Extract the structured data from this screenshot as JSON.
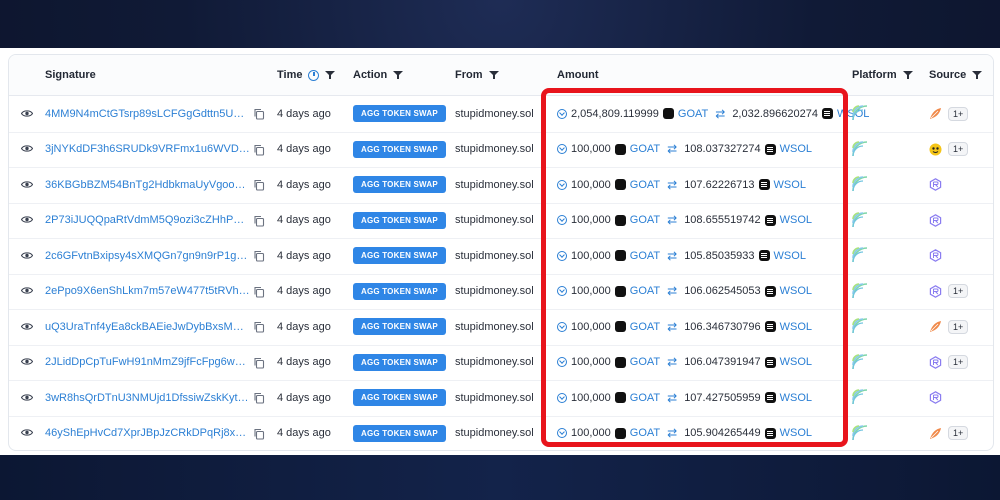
{
  "columns": {
    "signature": "Signature",
    "time": "Time",
    "action": "Action",
    "from": "From",
    "amount": "Amount",
    "platform": "Platform",
    "source": "Source"
  },
  "colors": {
    "accent": "#2b7fd4",
    "badge": "#2f86e6",
    "highlight": "#e8141c"
  },
  "rows": [
    {
      "signature": "4MM9N4mCtGTsrp89sLCFGgGdttn5UYnW...",
      "time": "4 days ago",
      "action": "AGG TOKEN SWAP",
      "from": "stupidmoney.sol",
      "amount_in": "2,054,809.119999",
      "token_in": "GOAT",
      "amount_out": "2,032.896620274",
      "token_out": "WSOL",
      "source_icon": "orange-feather-icon",
      "source_extra": "1+"
    },
    {
      "signature": "3jNYKdDF3h6SRUDk9VRFmx1u6WVDkgUrc...",
      "time": "4 days ago",
      "action": "AGG TOKEN SWAP",
      "from": "stupidmoney.sol",
      "amount_in": "100,000",
      "token_in": "GOAT",
      "amount_out": "108.037327274",
      "token_out": "WSOL",
      "source_icon": "yellow-face-icon",
      "source_extra": "1+"
    },
    {
      "signature": "36KBGbBZM54BnTg2HdbkmaUyVgoo7qaX...",
      "time": "4 days ago",
      "action": "AGG TOKEN SWAP",
      "from": "stupidmoney.sol",
      "amount_in": "100,000",
      "token_in": "GOAT",
      "amount_out": "107.62226713",
      "token_out": "WSOL",
      "source_icon": "raydium-icon",
      "source_extra": ""
    },
    {
      "signature": "2P73iJUQQpaRtVdmM5Q9ozi3cZHhPWSo...",
      "time": "4 days ago",
      "action": "AGG TOKEN SWAP",
      "from": "stupidmoney.sol",
      "amount_in": "100,000",
      "token_in": "GOAT",
      "amount_out": "108.655519742",
      "token_out": "WSOL",
      "source_icon": "raydium-icon",
      "source_extra": ""
    },
    {
      "signature": "2c6GFvtnBxipsy4sXMQGn7gn9n9rP1gcVN...",
      "time": "4 days ago",
      "action": "AGG TOKEN SWAP",
      "from": "stupidmoney.sol",
      "amount_in": "100,000",
      "token_in": "GOAT",
      "amount_out": "105.85035933",
      "token_out": "WSOL",
      "source_icon": "raydium-icon",
      "source_extra": ""
    },
    {
      "signature": "2ePpo9X6enShLkm7m57eW477t5tRVhE6iL...",
      "time": "4 days ago",
      "action": "AGG TOKEN SWAP",
      "from": "stupidmoney.sol",
      "amount_in": "100,000",
      "token_in": "GOAT",
      "amount_out": "106.062545053",
      "token_out": "WSOL",
      "source_icon": "raydium-icon",
      "source_extra": "1+"
    },
    {
      "signature": "uQ3UraTnf4yEa8ckBAEieJwDybBxsMWp8D...",
      "time": "4 days ago",
      "action": "AGG TOKEN SWAP",
      "from": "stupidmoney.sol",
      "amount_in": "100,000",
      "token_in": "GOAT",
      "amount_out": "106.346730796",
      "token_out": "WSOL",
      "source_icon": "orange-feather-icon",
      "source_extra": "1+"
    },
    {
      "signature": "2JLidDpCpTuFwH91nMmZ9jfFcFpg6wEaK...",
      "time": "4 days ago",
      "action": "AGG TOKEN SWAP",
      "from": "stupidmoney.sol",
      "amount_in": "100,000",
      "token_in": "GOAT",
      "amount_out": "106.047391947",
      "token_out": "WSOL",
      "source_icon": "raydium-icon",
      "source_extra": "1+"
    },
    {
      "signature": "3wR8hsQrDTnU3NMUjd1DfssiwZskKytoijV...",
      "time": "4 days ago",
      "action": "AGG TOKEN SWAP",
      "from": "stupidmoney.sol",
      "amount_in": "100,000",
      "token_in": "GOAT",
      "amount_out": "107.427505959",
      "token_out": "WSOL",
      "source_icon": "raydium-icon",
      "source_extra": ""
    },
    {
      "signature": "46yShEpHvCd7XprJBpJzCRkDPqRj8xHgkY...",
      "time": "4 days ago",
      "action": "AGG TOKEN SWAP",
      "from": "stupidmoney.sol",
      "amount_in": "100,000",
      "token_in": "GOAT",
      "amount_out": "105.904265449",
      "token_out": "WSOL",
      "source_icon": "orange-feather-icon",
      "source_extra": "1+"
    }
  ]
}
